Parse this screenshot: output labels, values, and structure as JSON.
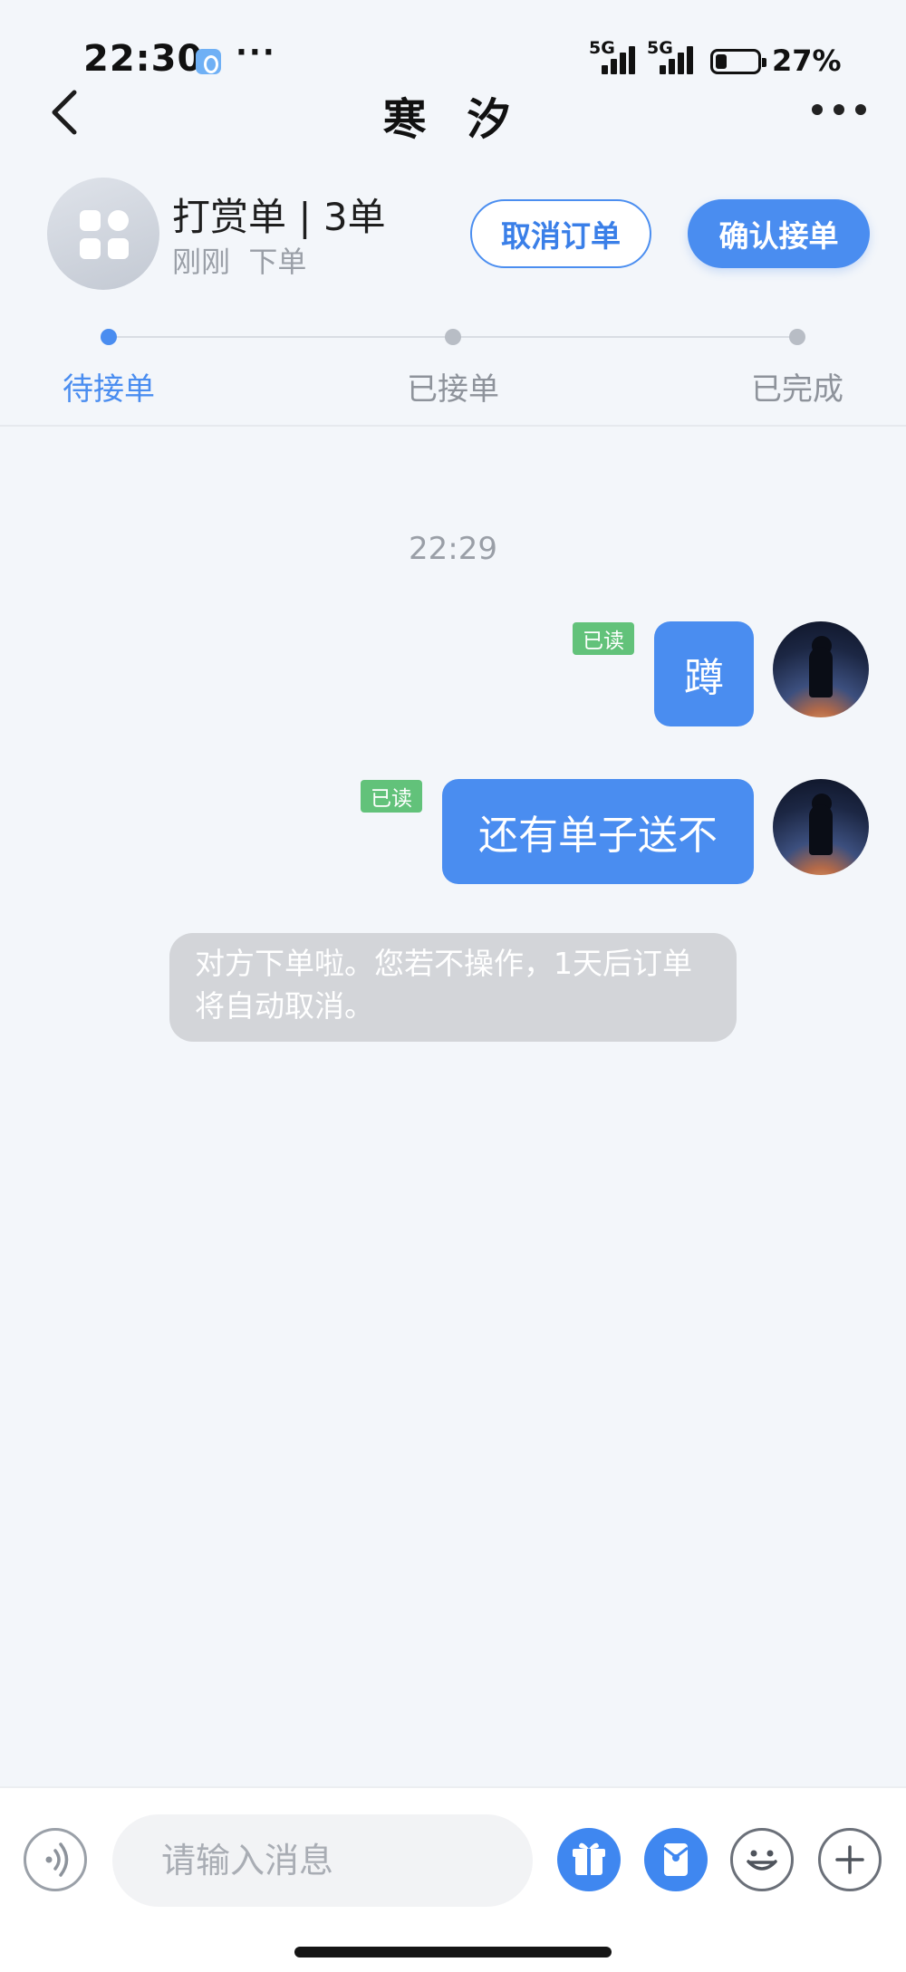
{
  "status_bar": {
    "time": "22:30",
    "dots": "···",
    "network_1": "5G",
    "network_2": "5G",
    "battery_percent": "27%",
    "battery_level": 0.27,
    "icons": [
      "app-notification-icon",
      "signal-icon",
      "battery-icon"
    ]
  },
  "nav": {
    "title": "寒 汐",
    "back_icon": "chevron-left-icon",
    "more_icon": "more-dots-icon"
  },
  "order": {
    "avatar_icon": "app-grid-icon",
    "title": "打赏单 | 3单",
    "subtitle": "刚刚  下单",
    "cancel_label": "取消订单",
    "confirm_label": "确认接单"
  },
  "progress": {
    "steps": [
      {
        "label": "待接单",
        "active": true
      },
      {
        "label": "已接单",
        "active": false
      },
      {
        "label": "已完成",
        "active": false
      }
    ],
    "active_color": "#4a8df0",
    "inactive_color": "#b8bdc5"
  },
  "chat": {
    "timestamp": "22:29",
    "messages": [
      {
        "text": "蹲",
        "read_label": "已读"
      },
      {
        "text": "还有单子送不",
        "read_label": "已读"
      }
    ],
    "system_note": "对方下单啦。您若不操作，1天后订单将自动取消。"
  },
  "input_bar": {
    "placeholder": "请输入消息",
    "icons": [
      "voice-icon",
      "gift-icon",
      "red-packet-icon",
      "emoji-icon",
      "plus-icon"
    ]
  },
  "colors": {
    "accent": "#4a8df0",
    "read_badge": "#62c27a",
    "background": "#f3f6fa"
  }
}
